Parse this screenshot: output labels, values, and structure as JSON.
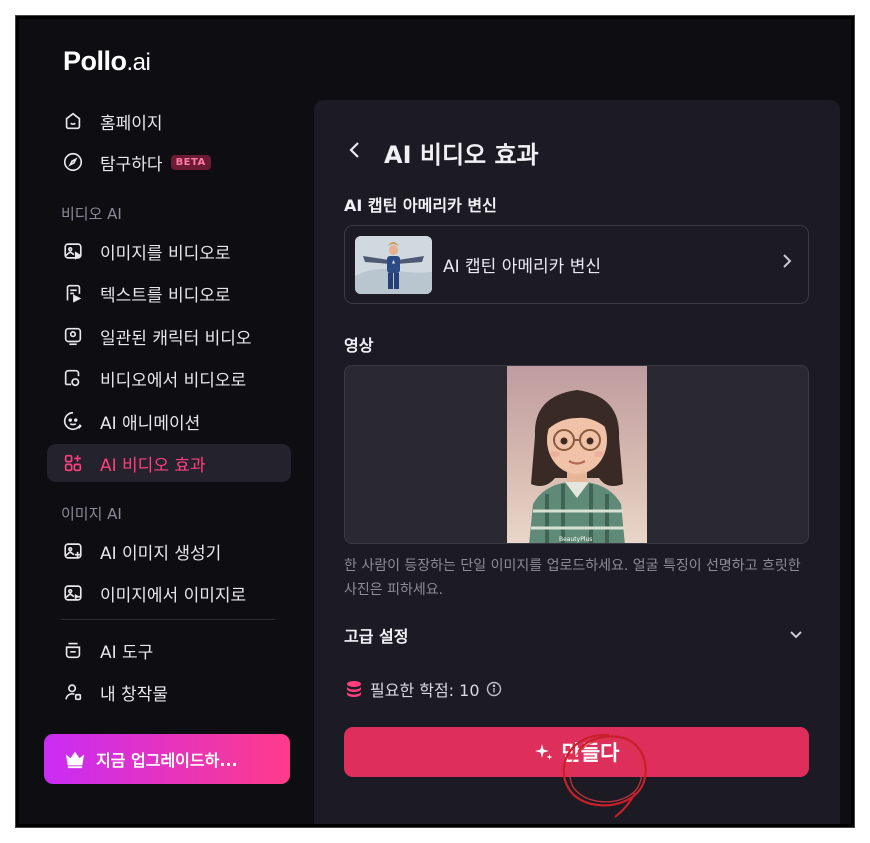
{
  "brand": {
    "name": "Pollo",
    "suffix": ".ai"
  },
  "sidebar": {
    "items": [
      {
        "label": "홈페이지",
        "icon": "home-icon"
      },
      {
        "label": "탐구하다",
        "icon": "compass-icon",
        "badge": "BETA"
      }
    ],
    "video_section": {
      "title": "비디오 AI",
      "items": [
        {
          "label": "이미지를 비디오로",
          "icon": "image-video-icon"
        },
        {
          "label": "텍스트를 비디오로",
          "icon": "text-video-icon"
        },
        {
          "label": "일관된 캐릭터 비디오",
          "icon": "character-icon"
        },
        {
          "label": "비디오에서 비디오로",
          "icon": "video-video-icon"
        },
        {
          "label": "AI 애니메이션",
          "icon": "animation-icon"
        },
        {
          "label": "AI 비디오 효과",
          "icon": "effects-icon",
          "active": true
        }
      ]
    },
    "image_section": {
      "title": "이미지 AI",
      "items": [
        {
          "label": "AI 이미지 생성기",
          "icon": "image-generator-icon"
        },
        {
          "label": "이미지에서 이미지로",
          "icon": "image-image-icon"
        }
      ]
    },
    "tools": [
      {
        "label": "AI 도구",
        "icon": "tools-icon"
      },
      {
        "label": "내 창작물",
        "icon": "user-creations-icon"
      }
    ],
    "upgrade_label": "지금 업그레이드하..."
  },
  "main": {
    "title": "AI 비디오 효과",
    "effect_label": "AI 캡틴 아메리카 변신",
    "effect_selected": "AI 캡틴 아메리카 변신",
    "video_label": "영상",
    "video_watermark": "BeautyPlus",
    "hint": "한 사람이 등장하는 단일 이미지를 업로드하세요. 얼굴 특징이 선명하고 흐릿한 사진은 피하세요.",
    "advanced_label": "고급 설정",
    "credits_label": "필요한 학점: 10",
    "create_label": "만들다"
  },
  "colors": {
    "accent": "#ff3f7e",
    "create_button": "#de2e5b",
    "panel_bg": "#1c1b24",
    "sidebar_bg": "#0e0e12"
  }
}
